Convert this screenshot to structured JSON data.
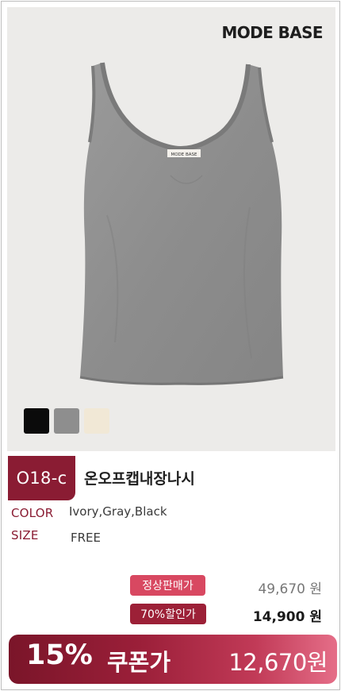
{
  "header": {
    "brand": "MODE BASE"
  },
  "product": {
    "image_label": "MODE BASE",
    "code": "O18-c",
    "name": "온오프캡내장나시",
    "color_label": "COLOR",
    "colors_value": "Ivory,Gray,Black",
    "size_label": "SIZE",
    "size_value": "FREE",
    "swatches": [
      {
        "name": "black",
        "color": "#0b0b0b"
      },
      {
        "name": "gray",
        "color": "#8e8e8e"
      },
      {
        "name": "ivory",
        "color": "#f1e8d6"
      }
    ]
  },
  "pricing": {
    "regular_label": "정상판매가",
    "regular_price": "49,670 원",
    "discount_label": "70%할인가",
    "discount_price": "14,900 원",
    "coupon_percent": "15%",
    "coupon_label": "쿠폰가",
    "coupon_price": "12,670원"
  },
  "colors": {
    "brand_accent": "#8a1c33",
    "tag_pink": "#d84861",
    "tag_dark": "#9c2037"
  }
}
